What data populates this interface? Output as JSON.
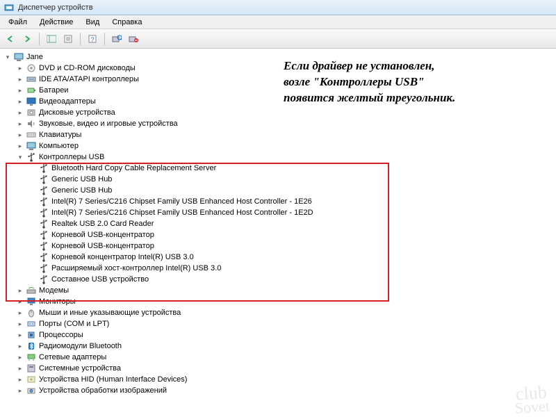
{
  "window": {
    "title": "Диспетчер устройств"
  },
  "menu": {
    "file": "Файл",
    "action": "Действие",
    "view": "Вид",
    "help": "Справка"
  },
  "tree": {
    "root": "Jane",
    "categories": [
      {
        "label": "DVD и CD-ROM дисководы",
        "icon": "disc"
      },
      {
        "label": "IDE ATA/ATAPI контроллеры",
        "icon": "ide"
      },
      {
        "label": "Батареи",
        "icon": "battery"
      },
      {
        "label": "Видеоадаптеры",
        "icon": "display"
      },
      {
        "label": "Дисковые устройства",
        "icon": "disk"
      },
      {
        "label": "Звуковые, видео и игровые устройства",
        "icon": "sound"
      },
      {
        "label": "Клавиатуры",
        "icon": "keyboard"
      },
      {
        "label": "Компьютер",
        "icon": "computer"
      },
      {
        "label": "Контроллеры USB",
        "icon": "usb",
        "expanded": true
      },
      {
        "label": "Модемы",
        "icon": "modem"
      },
      {
        "label": "Мониторы",
        "icon": "monitor"
      },
      {
        "label": "Мыши и иные указывающие устройства",
        "icon": "mouse"
      },
      {
        "label": "Порты (COM и LPT)",
        "icon": "port"
      },
      {
        "label": "Процессоры",
        "icon": "cpu"
      },
      {
        "label": "Радиомодули Bluetooth",
        "icon": "bluetooth"
      },
      {
        "label": "Сетевые адаптеры",
        "icon": "network"
      },
      {
        "label": "Системные устройства",
        "icon": "system"
      },
      {
        "label": "Устройства HID (Human Interface Devices)",
        "icon": "hid"
      },
      {
        "label": "Устройства обработки изображений",
        "icon": "imaging"
      }
    ],
    "usb_children": [
      "Bluetooth Hard Copy Cable Replacement Server",
      "Generic USB Hub",
      "Generic USB Hub",
      "Intel(R) 7 Series/C216 Chipset Family USB Enhanced Host Controller - 1E26",
      "Intel(R) 7 Series/C216 Chipset Family USB Enhanced Host Controller - 1E2D",
      "Realtek USB 2.0 Card Reader",
      "Корневой USB-концентратор",
      "Корневой USB-концентратор",
      "Корневой концентратор Intel(R) USB 3.0",
      "Расширяемый хост-контроллер Intel(R) USB 3.0",
      "Составное USB устройство"
    ]
  },
  "annotation": {
    "line1": "Если драйвер не установлен,",
    "line2": "возле \"Контроллеры USB\"",
    "line3": "появится желтый треугольник."
  },
  "watermark": {
    "line1": "club",
    "line2": "Sovet"
  }
}
